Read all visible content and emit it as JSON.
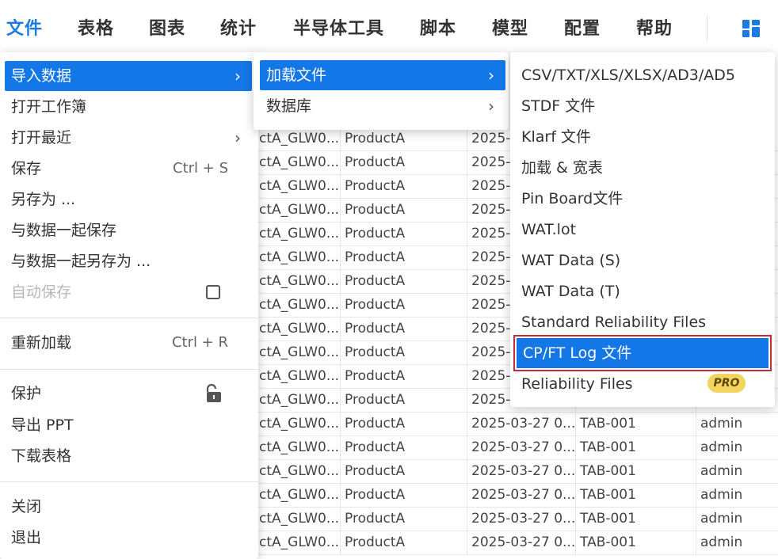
{
  "menubar": {
    "items": [
      "文件",
      "表格",
      "图表",
      "统计",
      "半导体工具",
      "脚本",
      "模型",
      "配置",
      "帮助"
    ],
    "active_index": 0,
    "layout_icon": "layout-grid-icon",
    "accent_color": "#1a7be0"
  },
  "file_menu": {
    "import_data": "导入数据",
    "open_workbook": "打开工作簿",
    "open_recent": "打开最近",
    "save": "保存",
    "save_shortcut": "Ctrl + S",
    "save_as": "另存为 ...",
    "save_with_data": "与数据一起保存",
    "save_as_with_data": "与数据一起另存为 ...",
    "autosave": "自动保存",
    "reload": "重新加载",
    "reload_shortcut": "Ctrl + R",
    "protect": "保护",
    "export_ppt": "导出 PPT",
    "download_table": "下载表格",
    "close": "关闭",
    "exit": "退出"
  },
  "import_menu": {
    "load_file": "加载文件",
    "database": "数据库"
  },
  "load_menu": {
    "items": [
      "CSV/TXT/XLS/XLSX/AD3/AD5",
      "STDF 文件",
      "Klarf 文件",
      "加载 & 宽表",
      "Pin Board文件",
      "WAT.lot",
      "WAT Data (S)",
      "WAT Data (T)",
      "Standard Reliability Files",
      "CP/FT Log 文件",
      "Reliability Files"
    ],
    "highlighted_index": 9,
    "pro_badge": "PRO"
  },
  "table": {
    "rows": [
      [
        "ctA_GLW0...",
        "ProductA",
        "2025-0",
        "",
        ""
      ],
      [
        "ctA_GLW0...",
        "ProductA",
        "2025-0",
        "",
        ""
      ],
      [
        "ctA_GLW0...",
        "ProductA",
        "2025-0",
        "",
        ""
      ],
      [
        "ctA_GLW0...",
        "ProductA",
        "2025-0",
        "",
        ""
      ],
      [
        "ctA_GLW0...",
        "ProductA",
        "2025-0",
        "",
        ""
      ],
      [
        "ctA_GLW0...",
        "ProductA",
        "2025-0",
        "",
        ""
      ],
      [
        "ctA_GLW0...",
        "ProductA",
        "2025-0",
        "",
        ""
      ],
      [
        "ctA_GLW0...",
        "ProductA",
        "2025-0",
        "",
        ""
      ],
      [
        "ctA_GLW0...",
        "ProductA",
        "2025-0",
        "",
        ""
      ],
      [
        "ctA_GLW0...",
        "ProductA",
        "2025-0",
        "",
        ""
      ],
      [
        "ctA_GLW0...",
        "ProductA",
        "2025-0",
        "",
        ""
      ],
      [
        "ctA_GLW0...",
        "ProductA",
        "2025-0",
        "",
        ""
      ],
      [
        "ctA_GLW0...",
        "ProductA",
        "2025-03-27 0...",
        "TAB-001",
        "admin"
      ],
      [
        "ctA_GLW0...",
        "ProductA",
        "2025-03-27 0...",
        "TAB-001",
        "admin"
      ],
      [
        "ctA_GLW0...",
        "ProductA",
        "2025-03-27 0...",
        "TAB-001",
        "admin"
      ],
      [
        "ctA_GLW0...",
        "ProductA",
        "2025-03-27 0...",
        "TAB-001",
        "admin"
      ],
      [
        "ctA_GLW0...",
        "ProductA",
        "2025-03-27 0...",
        "TAB-001",
        "admin"
      ],
      [
        "ctA_GLW0...",
        "ProductA",
        "2025-03-27 0...",
        "TAB-001",
        "admin"
      ]
    ]
  }
}
